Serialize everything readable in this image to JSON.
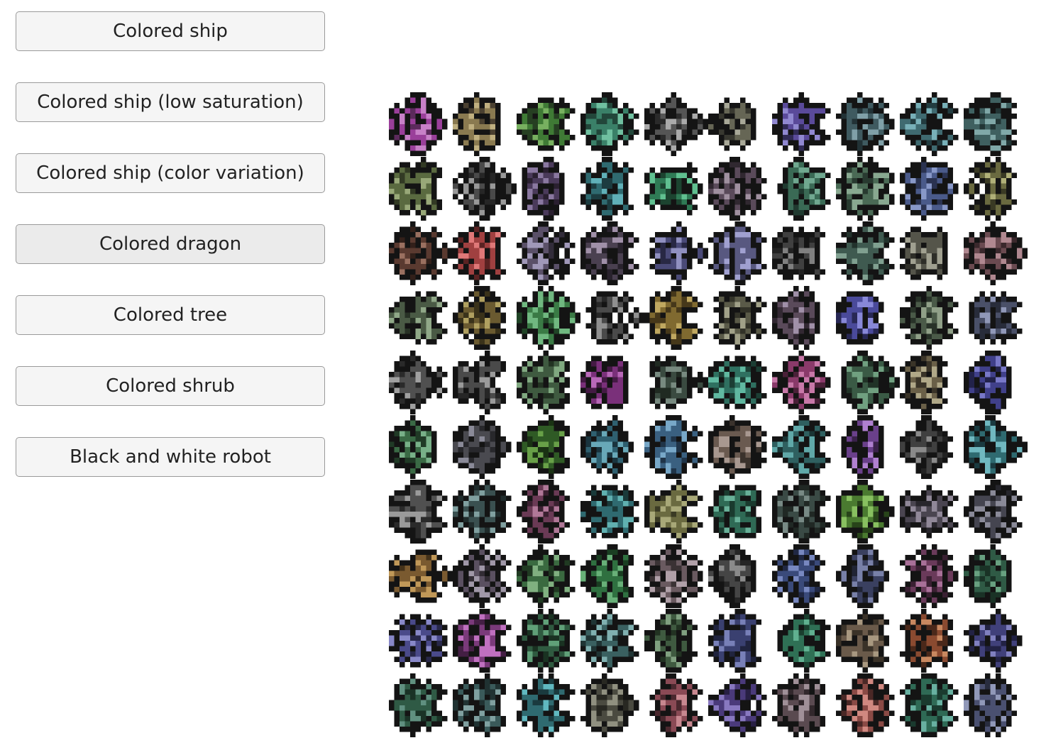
{
  "buttons": [
    {
      "label": "Colored ship",
      "active": false
    },
    {
      "label": "Colored ship (low saturation)",
      "active": false
    },
    {
      "label": "Colored ship (color variation)",
      "active": false
    },
    {
      "label": "Colored dragon",
      "active": true
    },
    {
      "label": "Colored tree",
      "active": false
    },
    {
      "label": "Colored shrub",
      "active": false
    },
    {
      "label": "Black and white robot",
      "active": false
    }
  ],
  "sprite_grid": {
    "rows": 10,
    "columns": 10,
    "sprite_name": "dragon-sprite",
    "outline_color": "#141414",
    "palettes": [
      [
        "#9a3f9a",
        "#c880c8",
        "#5c2a5c"
      ],
      [
        "#8a7a50",
        "#c0b080",
        "#4a4030"
      ],
      [
        "#3f7a35",
        "#78b060",
        "#263f22"
      ],
      [
        "#3a8068",
        "#70c0a0",
        "#22463a"
      ],
      [
        "#555555",
        "#aaaaaa",
        "#2a2a2a"
      ],
      [
        "#666655",
        "#a8a898",
        "#383830"
      ],
      [
        "#5a4a9a",
        "#9088d0",
        "#302a55"
      ],
      [
        "#3f5a60",
        "#80a0a8",
        "#223236"
      ],
      [
        "#3f6a70",
        "#78b0b8",
        "#223c40"
      ],
      [
        "#3f6060",
        "#80a8a8",
        "#223535"
      ],
      [
        "#5a6a40",
        "#98a878",
        "#323a24"
      ],
      [
        "#4a4a4a",
        "#999999",
        "#262626"
      ],
      [
        "#4a3a5a",
        "#8a78a0",
        "#2a2030"
      ],
      [
        "#2f6a70",
        "#60b0b8",
        "#1c3c40"
      ],
      [
        "#2f7a55",
        "#60c090",
        "#1c4430"
      ],
      [
        "#5a4a5a",
        "#a090a0",
        "#302830"
      ],
      [
        "#3a6a55",
        "#70a890",
        "#203a30"
      ],
      [
        "#4a6a55",
        "#88a890",
        "#283a30"
      ],
      [
        "#4a5a8a",
        "#8898c8",
        "#2a3250"
      ],
      [
        "#6a6a40",
        "#b0b078",
        "#3a3a24"
      ],
      [
        "#5a3a30",
        "#9a7060",
        "#32201a"
      ],
      [
        "#a04040",
        "#e07878",
        "#5a2222"
      ],
      [
        "#5a5068",
        "#a098b8",
        "#322c3a"
      ],
      [
        "#4a4050",
        "#a090a8",
        "#28222c"
      ],
      [
        "#4a4a78",
        "#9090c0",
        "#282844"
      ],
      [
        "#585880",
        "#a0a0d0",
        "#303048"
      ],
      [
        "#404040",
        "#808080",
        "#222222"
      ],
      [
        "#3f5a50",
        "#80a090",
        "#22322c"
      ],
      [
        "#55554a",
        "#a0a090",
        "#2e2e28"
      ],
      [
        "#6a4a50",
        "#b08890",
        "#3a282c"
      ],
      [
        "#4a5a45",
        "#90a888",
        "#283226"
      ],
      [
        "#6a5a30",
        "#b0a060",
        "#3a321a"
      ],
      [
        "#3a7a45",
        "#70b880",
        "#204426"
      ],
      [
        "#4a4a4a",
        "#909090",
        "#282828"
      ],
      [
        "#806a30",
        "#c0a860",
        "#46381a"
      ],
      [
        "#5a5a48",
        "#a0a088",
        "#323228"
      ],
      [
        "#5a4a5a",
        "#a090a8",
        "#322832"
      ],
      [
        "#4a4a9a",
        "#8888d8",
        "#282855"
      ],
      [
        "#4a5a48",
        "#90a088",
        "#283228"
      ],
      [
        "#4a5068",
        "#9098b8",
        "#282c3a"
      ],
      [
        "#505050",
        "#a0a0a0",
        "#2a2a2a"
      ],
      [
        "#4a4a4a",
        "#9a9a9a",
        "#262626"
      ],
      [
        "#3f5a40",
        "#80a880",
        "#223222"
      ],
      [
        "#7a307a",
        "#b868b8",
        "#441a44"
      ],
      [
        "#3a4a40",
        "#788a80",
        "#202a22"
      ],
      [
        "#2f7060",
        "#60b8a0",
        "#1c3e34"
      ],
      [
        "#8a3a6a",
        "#c878a8",
        "#4a2038"
      ],
      [
        "#3a5a45",
        "#70a080",
        "#203226"
      ],
      [
        "#6a6048",
        "#b0a888",
        "#3a3428"
      ],
      [
        "#40408a",
        "#7878c8",
        "#22224a"
      ],
      [
        "#3a6a45",
        "#78b088",
        "#203a26"
      ],
      [
        "#4a4a50",
        "#8a8a98",
        "#28282c"
      ],
      [
        "#2f5a25",
        "#68a048",
        "#1a3214"
      ],
      [
        "#2f6070",
        "#68a8b8",
        "#1a343e"
      ],
      [
        "#3a6080",
        "#78a8c8",
        "#203448"
      ],
      [
        "#6a5a50",
        "#a89890",
        "#3a322c"
      ],
      [
        "#2f6060",
        "#60a8a8",
        "#1a3434"
      ],
      [
        "#6a408a",
        "#b080d0",
        "#3a224a"
      ],
      [
        "#404040",
        "#8a8a8a",
        "#222222"
      ],
      [
        "#2f6a70",
        "#70b8c0",
        "#1a3a40"
      ],
      [
        "#505050",
        "#9a9a9a",
        "#2a2a2a"
      ],
      [
        "#3a5050",
        "#80a0a0",
        "#202c2c"
      ],
      [
        "#6a3a55",
        "#b07898",
        "#3a2030"
      ],
      [
        "#2f6a70",
        "#60b0b0",
        "#1a3a3a"
      ],
      [
        "#6a6a40",
        "#a8a878",
        "#3a3a24"
      ],
      [
        "#2f6a55",
        "#68b098",
        "#1a3a2e"
      ],
      [
        "#3a4a45",
        "#788a85",
        "#202824"
      ],
      [
        "#4a7a30",
        "#88c060",
        "#28441a"
      ],
      [
        "#4a4550",
        "#908898",
        "#28262c"
      ],
      [
        "#454550",
        "#8a8a98",
        "#26262c"
      ],
      [
        "#7a5a30",
        "#c09858",
        "#44321a"
      ],
      [
        "#5a5060",
        "#a098a8",
        "#322c34"
      ],
      [
        "#3a6a40",
        "#80b080",
        "#203a22"
      ],
      [
        "#2f7040",
        "#68b078",
        "#1a3e22"
      ],
      [
        "#6a5a60",
        "#b0a0a8",
        "#3a3234"
      ],
      [
        "#454545",
        "#8a8a8a",
        "#262626"
      ],
      [
        "#3a4a7a",
        "#7888c0",
        "#202844"
      ],
      [
        "#3a4060",
        "#7880a8",
        "#202434"
      ],
      [
        "#6a3a5a",
        "#a87098",
        "#3a2032"
      ],
      [
        "#2f5a45",
        "#68a080",
        "#1a3226"
      ],
      [
        "#4a4a8a",
        "#8888c8",
        "#28284a"
      ],
      [
        "#7a3a7a",
        "#c070c0",
        "#441f44"
      ],
      [
        "#2f5a40",
        "#60a078",
        "#1a3222"
      ],
      [
        "#3a6060",
        "#80b0b0",
        "#203434"
      ],
      [
        "#3f5a40",
        "#80a080",
        "#223222"
      ],
      [
        "#3a4070",
        "#7880b8",
        "#20243e"
      ],
      [
        "#2f7055",
        "#60b090",
        "#1a3e2e"
      ],
      [
        "#6a5a4a",
        "#a89880",
        "#3a3228"
      ],
      [
        "#8a4a30",
        "#c88860",
        "#4a281a"
      ],
      [
        "#40407a",
        "#8080c0",
        "#222244"
      ],
      [
        "#2f5a45",
        "#609080",
        "#1a3226"
      ],
      [
        "#3a5a5a",
        "#80a0a0",
        "#203232"
      ],
      [
        "#2f6a70",
        "#60b8c0",
        "#1a3a3e"
      ],
      [
        "#4a4a40",
        "#909080",
        "#282822"
      ],
      [
        "#8a4a55",
        "#c88890",
        "#4a282e"
      ],
      [
        "#4a3a7a",
        "#8878c0",
        "#282044"
      ],
      [
        "#5a4a50",
        "#a09098",
        "#32282c"
      ],
      [
        "#8a4a45",
        "#d08880",
        "#4a2826"
      ],
      [
        "#2f6a55",
        "#68b0a0",
        "#1a3a2e"
      ],
      [
        "#4a5070",
        "#9098b8",
        "#282c3e"
      ]
    ]
  }
}
